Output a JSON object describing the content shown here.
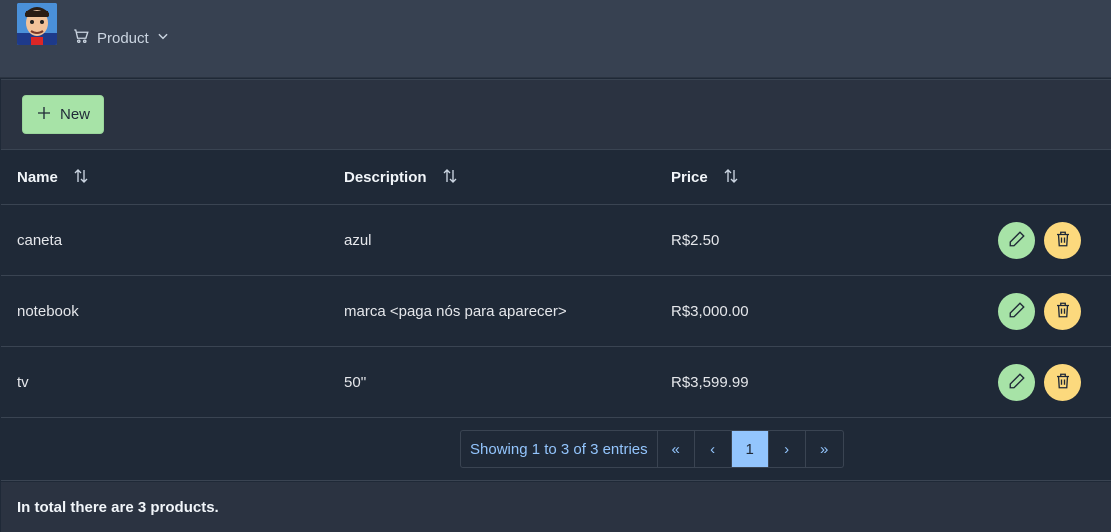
{
  "header": {
    "menu_label": "Product",
    "menu_icon": "cart-icon",
    "dropdown_icon": "chevron-down-icon"
  },
  "toolbar": {
    "new_label": "New"
  },
  "table": {
    "columns": [
      "Name",
      "Description",
      "Price"
    ],
    "rows": [
      {
        "name": "caneta",
        "description": "azul",
        "price": "R$2.50"
      },
      {
        "name": "notebook",
        "description": "marca <paga nós para aparecer>",
        "price": "R$3,000.00"
      },
      {
        "name": "tv",
        "description": "50''",
        "price": "R$3,599.99"
      }
    ]
  },
  "pagination": {
    "info": "Showing 1 to 3 of 3 entries",
    "first": "«",
    "prev": "‹",
    "page": "1",
    "next": "›",
    "last": "»"
  },
  "footer": {
    "summary": "In total there are 3 products."
  },
  "colors": {
    "success": "#a7e3a7",
    "warning": "#fcd97d",
    "info": "#93c5fd",
    "background": "#1f2937"
  }
}
